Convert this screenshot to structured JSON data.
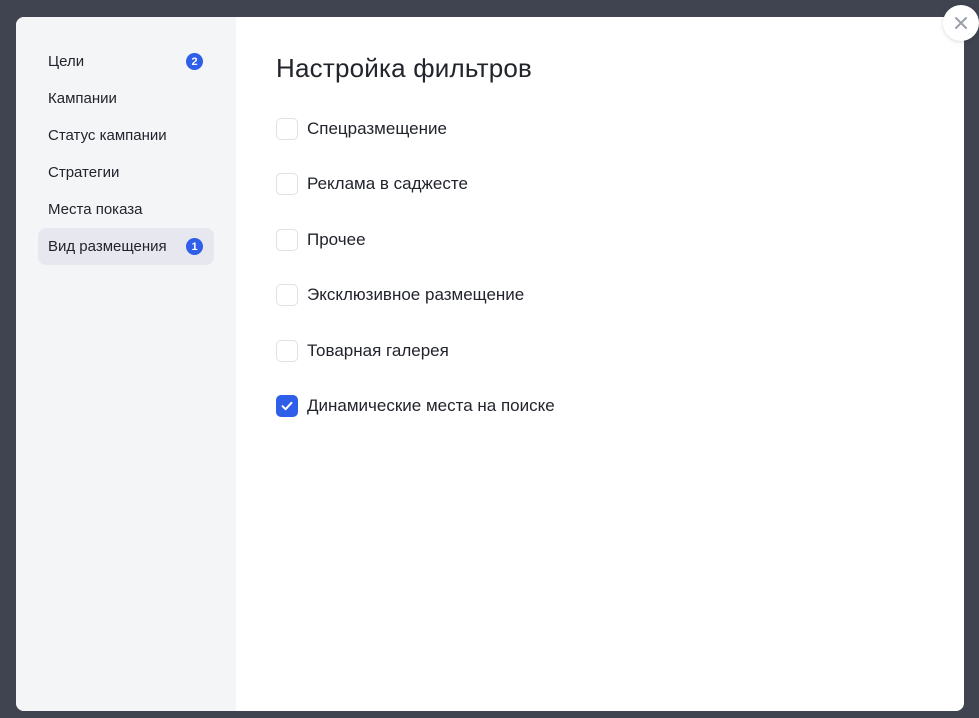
{
  "sidebar": {
    "items": [
      {
        "label": "Цели",
        "badge": "2",
        "active": false
      },
      {
        "label": "Кампании",
        "badge": null,
        "active": false
      },
      {
        "label": "Статус кампании",
        "badge": null,
        "active": false
      },
      {
        "label": "Стратегии",
        "badge": null,
        "active": false
      },
      {
        "label": "Места показа",
        "badge": null,
        "active": false
      },
      {
        "label": "Вид размещения",
        "badge": "1",
        "active": true
      }
    ]
  },
  "main": {
    "title": "Настройка фильтров",
    "options": [
      {
        "label": "Спецразмещение",
        "checked": false
      },
      {
        "label": "Реклама в саджесте",
        "checked": false
      },
      {
        "label": "Прочее",
        "checked": false
      },
      {
        "label": "Эксклюзивное размещение",
        "checked": false
      },
      {
        "label": "Товарная галерея",
        "checked": false
      },
      {
        "label": "Динамические места на поиске",
        "checked": true
      }
    ]
  },
  "close_icon": "close-icon",
  "check_icon": "checkmark-icon",
  "colors": {
    "accent": "#2f5fe8",
    "sidebar_bg": "#f4f5f7",
    "active_item_bg": "#e7e8ef",
    "backdrop": "#3f4450",
    "text": "#21242b"
  }
}
